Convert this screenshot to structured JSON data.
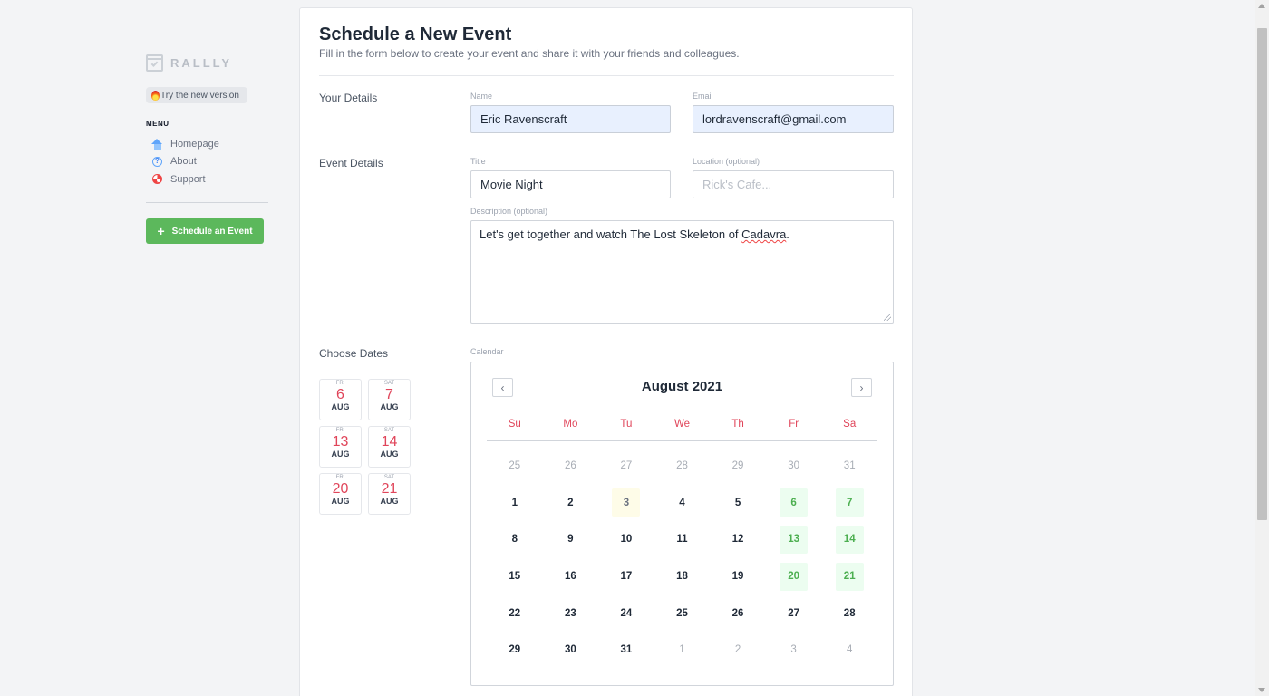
{
  "sidebar": {
    "logo_text": "RALLLY",
    "try_label": "Try the new version",
    "menu_title": "MENU",
    "items": [
      {
        "label": "Homepage",
        "icon": "home-icon"
      },
      {
        "label": "About",
        "icon": "question-circle-icon"
      },
      {
        "label": "Support",
        "icon": "lifebuoy-icon"
      }
    ],
    "schedule_label": "Schedule an Event"
  },
  "header": {
    "title": "Schedule a New Event",
    "subtitle": "Fill in the form below to create your event and share it with your friends and colleagues."
  },
  "your_details": {
    "section_label": "Your Details",
    "name_label": "Name",
    "name_value": "Eric Ravenscraft",
    "email_label": "Email",
    "email_value": "lordravenscraft@gmail.com"
  },
  "event_details": {
    "section_label": "Event Details",
    "title_label": "Title",
    "title_value": "Movie Night",
    "location_label": "Location (optional)",
    "location_placeholder": "Rick's Cafe...",
    "description_label": "Description (optional)",
    "description_before": "Let's get together and watch The Lost Skeleton of ",
    "description_misspelled": "Cadavra",
    "description_after": "."
  },
  "dates": {
    "section_label": "Choose Dates",
    "calendar_label": "Calendar",
    "selected": [
      {
        "dow": "FRI",
        "day": "6",
        "month": "AUG"
      },
      {
        "dow": "SAT",
        "day": "7",
        "month": "AUG"
      },
      {
        "dow": "FRI",
        "day": "13",
        "month": "AUG"
      },
      {
        "dow": "SAT",
        "day": "14",
        "month": "AUG"
      },
      {
        "dow": "FRI",
        "day": "20",
        "month": "AUG"
      },
      {
        "dow": "SAT",
        "day": "21",
        "month": "AUG"
      }
    ]
  },
  "calendar": {
    "month_title": "August 2021",
    "weekdays": [
      "Su",
      "Mo",
      "Tu",
      "We",
      "Th",
      "Fr",
      "Sa"
    ],
    "days": [
      {
        "n": "25",
        "state": "other"
      },
      {
        "n": "26",
        "state": "other"
      },
      {
        "n": "27",
        "state": "other"
      },
      {
        "n": "28",
        "state": "other"
      },
      {
        "n": "29",
        "state": "other"
      },
      {
        "n": "30",
        "state": "other"
      },
      {
        "n": "31",
        "state": "other"
      },
      {
        "n": "1",
        "state": "normal"
      },
      {
        "n": "2",
        "state": "normal"
      },
      {
        "n": "3",
        "state": "today"
      },
      {
        "n": "4",
        "state": "normal"
      },
      {
        "n": "5",
        "state": "normal"
      },
      {
        "n": "6",
        "state": "selected"
      },
      {
        "n": "7",
        "state": "selected"
      },
      {
        "n": "8",
        "state": "normal"
      },
      {
        "n": "9",
        "state": "normal"
      },
      {
        "n": "10",
        "state": "normal"
      },
      {
        "n": "11",
        "state": "normal"
      },
      {
        "n": "12",
        "state": "normal"
      },
      {
        "n": "13",
        "state": "selected"
      },
      {
        "n": "14",
        "state": "selected"
      },
      {
        "n": "15",
        "state": "normal"
      },
      {
        "n": "16",
        "state": "normal"
      },
      {
        "n": "17",
        "state": "normal"
      },
      {
        "n": "18",
        "state": "normal"
      },
      {
        "n": "19",
        "state": "normal"
      },
      {
        "n": "20",
        "state": "selected"
      },
      {
        "n": "21",
        "state": "selected"
      },
      {
        "n": "22",
        "state": "normal"
      },
      {
        "n": "23",
        "state": "normal"
      },
      {
        "n": "24",
        "state": "normal"
      },
      {
        "n": "25",
        "state": "normal"
      },
      {
        "n": "26",
        "state": "normal"
      },
      {
        "n": "27",
        "state": "normal"
      },
      {
        "n": "28",
        "state": "normal"
      },
      {
        "n": "29",
        "state": "normal"
      },
      {
        "n": "30",
        "state": "normal"
      },
      {
        "n": "31",
        "state": "normal"
      },
      {
        "n": "1",
        "state": "other"
      },
      {
        "n": "2",
        "state": "other"
      },
      {
        "n": "3",
        "state": "other"
      },
      {
        "n": "4",
        "state": "other"
      }
    ]
  },
  "colors": {
    "accent_red": "#e0455a",
    "green_button": "#5cb85c",
    "selected_day": "#4caf50",
    "autofill_bg": "#e8f0fe"
  }
}
